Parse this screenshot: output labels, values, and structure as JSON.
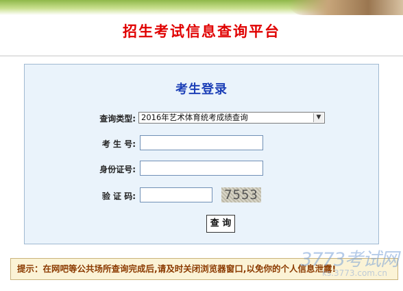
{
  "header": {
    "site_title": "招生考试信息查询平台"
  },
  "login": {
    "heading": "考生登录",
    "query_type_label": "查询类型:",
    "query_type_value": "2016年艺术体育统考成绩查询",
    "exam_number_label": "考 生 号:",
    "exam_number_value": "",
    "id_number_label": "身份证号:",
    "id_number_value": "",
    "captcha_label": "验 证 码:",
    "captcha_value": "",
    "captcha_image_text": "7553",
    "submit_label": "查 询"
  },
  "notice": {
    "text": "提示：在网吧等公共场所查询完成后,请及时关闭浏览器窗口,以免你的个人信息泄露!"
  },
  "watermark": {
    "main": "3773考试网",
    "sub": "ks.3773.com.cn"
  },
  "colors": {
    "title_red": "#e00000",
    "heading_blue": "#1c3fb7",
    "panel_bg": "#eaf3fb",
    "notice_bg": "#fbf3d6",
    "notice_text": "#8b3a00"
  },
  "icons": {
    "select_arrow": "chevron-down-icon"
  }
}
